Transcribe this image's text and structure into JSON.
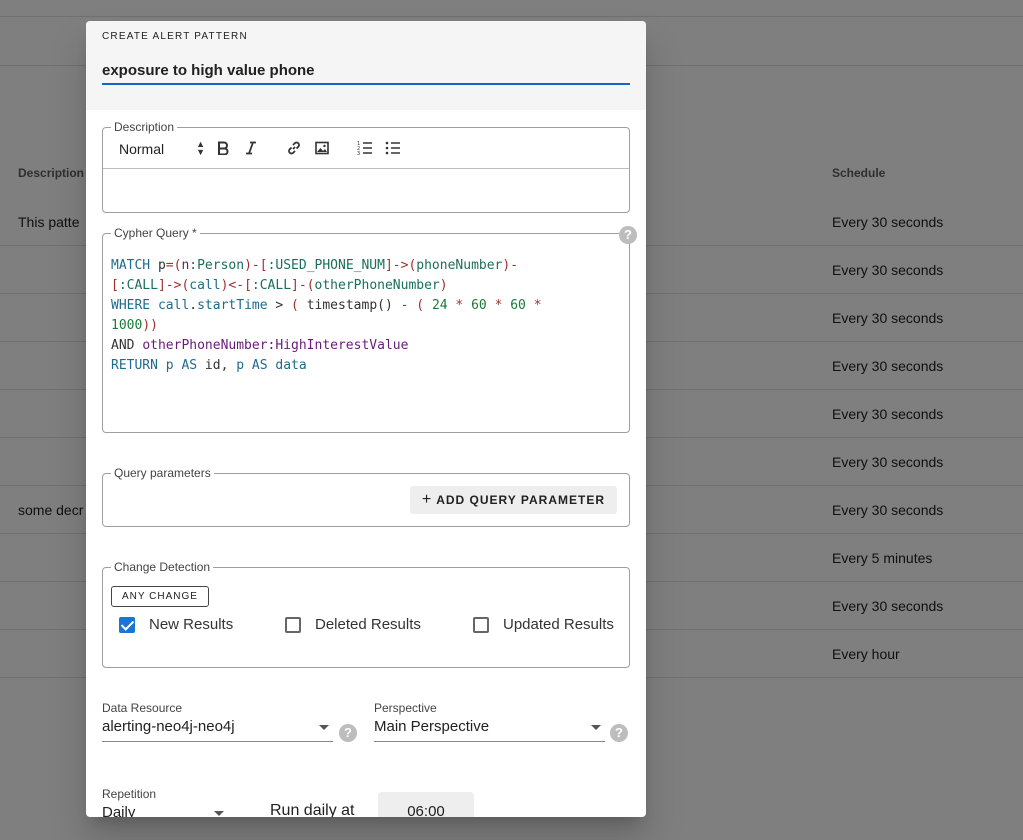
{
  "background": {
    "columns": {
      "description": "Description",
      "schedule": "Schedule"
    },
    "rows": [
      {
        "description": "This patte",
        "schedule": "Every 30 seconds"
      },
      {
        "description": "",
        "schedule": "Every 30 seconds"
      },
      {
        "description": "",
        "schedule": "Every 30 seconds"
      },
      {
        "description": "",
        "schedule": "Every 30 seconds"
      },
      {
        "description": "",
        "schedule": "Every 30 seconds"
      },
      {
        "description": "",
        "schedule": "Every 30 seconds"
      },
      {
        "description": "some decr",
        "schedule": "Every 30 seconds"
      },
      {
        "description": "",
        "schedule": "Every 5 minutes"
      },
      {
        "description": "",
        "schedule": "Every 30 seconds"
      },
      {
        "description": "",
        "schedule": "Every hour"
      }
    ]
  },
  "dialog": {
    "title": "CREATE ALERT PATTERN",
    "name_value": "exposure to high value phone",
    "description": {
      "label": "Description",
      "format_value": "Normal",
      "toolbar_icons": [
        "bold-icon",
        "italic-icon",
        "link-icon",
        "image-icon",
        "ordered-list-icon",
        "bullet-list-icon"
      ]
    },
    "cypher": {
      "label": "Cypher Query *",
      "help": "?"
    },
    "query_parameters": {
      "label": "Query parameters",
      "add_button": "ADD QUERY PARAMETER",
      "add_icon": "+"
    },
    "change_detection": {
      "label": "Change Detection",
      "chip": "ANY CHANGE",
      "options": [
        {
          "label": "New Results",
          "checked": true
        },
        {
          "label": "Deleted Results",
          "checked": false
        },
        {
          "label": "Updated Results",
          "checked": false
        }
      ]
    },
    "data_resource": {
      "label": "Data Resource",
      "value": "alerting-neo4j-neo4j",
      "help": "?"
    },
    "perspective": {
      "label": "Perspective",
      "value": "Main Perspective",
      "help": "?"
    },
    "repetition": {
      "label": "Repetition",
      "value": "Daily"
    },
    "run_daily": {
      "label": "Run daily at",
      "value": "06:00"
    }
  },
  "colors": {
    "accent": "#1976d2",
    "underline": "#1565c0"
  }
}
